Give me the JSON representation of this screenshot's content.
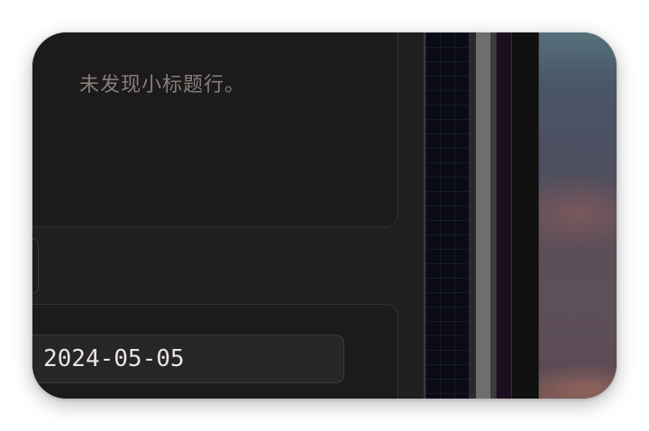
{
  "subheading_panel": {
    "empty_message": "未发现小标题行。"
  },
  "date_panel": {
    "date_value": "2024-05-05"
  }
}
